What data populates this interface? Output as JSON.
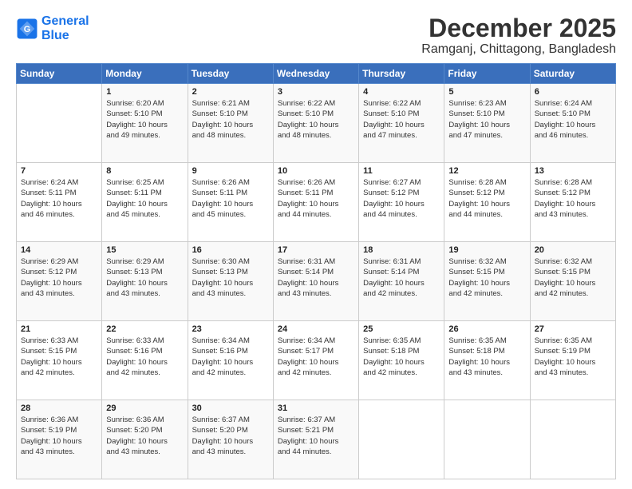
{
  "logo": {
    "line1": "General",
    "line2": "Blue"
  },
  "title": "December 2025",
  "location": "Ramganj, Chittagong, Bangladesh",
  "days_of_week": [
    "Sunday",
    "Monday",
    "Tuesday",
    "Wednesday",
    "Thursday",
    "Friday",
    "Saturday"
  ],
  "weeks": [
    [
      {
        "day": "",
        "info": ""
      },
      {
        "day": "1",
        "info": "Sunrise: 6:20 AM\nSunset: 5:10 PM\nDaylight: 10 hours\nand 49 minutes."
      },
      {
        "day": "2",
        "info": "Sunrise: 6:21 AM\nSunset: 5:10 PM\nDaylight: 10 hours\nand 48 minutes."
      },
      {
        "day": "3",
        "info": "Sunrise: 6:22 AM\nSunset: 5:10 PM\nDaylight: 10 hours\nand 48 minutes."
      },
      {
        "day": "4",
        "info": "Sunrise: 6:22 AM\nSunset: 5:10 PM\nDaylight: 10 hours\nand 47 minutes."
      },
      {
        "day": "5",
        "info": "Sunrise: 6:23 AM\nSunset: 5:10 PM\nDaylight: 10 hours\nand 47 minutes."
      },
      {
        "day": "6",
        "info": "Sunrise: 6:24 AM\nSunset: 5:10 PM\nDaylight: 10 hours\nand 46 minutes."
      }
    ],
    [
      {
        "day": "7",
        "info": "Sunrise: 6:24 AM\nSunset: 5:11 PM\nDaylight: 10 hours\nand 46 minutes."
      },
      {
        "day": "8",
        "info": "Sunrise: 6:25 AM\nSunset: 5:11 PM\nDaylight: 10 hours\nand 45 minutes."
      },
      {
        "day": "9",
        "info": "Sunrise: 6:26 AM\nSunset: 5:11 PM\nDaylight: 10 hours\nand 45 minutes."
      },
      {
        "day": "10",
        "info": "Sunrise: 6:26 AM\nSunset: 5:11 PM\nDaylight: 10 hours\nand 44 minutes."
      },
      {
        "day": "11",
        "info": "Sunrise: 6:27 AM\nSunset: 5:12 PM\nDaylight: 10 hours\nand 44 minutes."
      },
      {
        "day": "12",
        "info": "Sunrise: 6:28 AM\nSunset: 5:12 PM\nDaylight: 10 hours\nand 44 minutes."
      },
      {
        "day": "13",
        "info": "Sunrise: 6:28 AM\nSunset: 5:12 PM\nDaylight: 10 hours\nand 43 minutes."
      }
    ],
    [
      {
        "day": "14",
        "info": "Sunrise: 6:29 AM\nSunset: 5:12 PM\nDaylight: 10 hours\nand 43 minutes."
      },
      {
        "day": "15",
        "info": "Sunrise: 6:29 AM\nSunset: 5:13 PM\nDaylight: 10 hours\nand 43 minutes."
      },
      {
        "day": "16",
        "info": "Sunrise: 6:30 AM\nSunset: 5:13 PM\nDaylight: 10 hours\nand 43 minutes."
      },
      {
        "day": "17",
        "info": "Sunrise: 6:31 AM\nSunset: 5:14 PM\nDaylight: 10 hours\nand 43 minutes."
      },
      {
        "day": "18",
        "info": "Sunrise: 6:31 AM\nSunset: 5:14 PM\nDaylight: 10 hours\nand 42 minutes."
      },
      {
        "day": "19",
        "info": "Sunrise: 6:32 AM\nSunset: 5:15 PM\nDaylight: 10 hours\nand 42 minutes."
      },
      {
        "day": "20",
        "info": "Sunrise: 6:32 AM\nSunset: 5:15 PM\nDaylight: 10 hours\nand 42 minutes."
      }
    ],
    [
      {
        "day": "21",
        "info": "Sunrise: 6:33 AM\nSunset: 5:15 PM\nDaylight: 10 hours\nand 42 minutes."
      },
      {
        "day": "22",
        "info": "Sunrise: 6:33 AM\nSunset: 5:16 PM\nDaylight: 10 hours\nand 42 minutes."
      },
      {
        "day": "23",
        "info": "Sunrise: 6:34 AM\nSunset: 5:16 PM\nDaylight: 10 hours\nand 42 minutes."
      },
      {
        "day": "24",
        "info": "Sunrise: 6:34 AM\nSunset: 5:17 PM\nDaylight: 10 hours\nand 42 minutes."
      },
      {
        "day": "25",
        "info": "Sunrise: 6:35 AM\nSunset: 5:18 PM\nDaylight: 10 hours\nand 42 minutes."
      },
      {
        "day": "26",
        "info": "Sunrise: 6:35 AM\nSunset: 5:18 PM\nDaylight: 10 hours\nand 43 minutes."
      },
      {
        "day": "27",
        "info": "Sunrise: 6:35 AM\nSunset: 5:19 PM\nDaylight: 10 hours\nand 43 minutes."
      }
    ],
    [
      {
        "day": "28",
        "info": "Sunrise: 6:36 AM\nSunset: 5:19 PM\nDaylight: 10 hours\nand 43 minutes."
      },
      {
        "day": "29",
        "info": "Sunrise: 6:36 AM\nSunset: 5:20 PM\nDaylight: 10 hours\nand 43 minutes."
      },
      {
        "day": "30",
        "info": "Sunrise: 6:37 AM\nSunset: 5:20 PM\nDaylight: 10 hours\nand 43 minutes."
      },
      {
        "day": "31",
        "info": "Sunrise: 6:37 AM\nSunset: 5:21 PM\nDaylight: 10 hours\nand 44 minutes."
      },
      {
        "day": "",
        "info": ""
      },
      {
        "day": "",
        "info": ""
      },
      {
        "day": "",
        "info": ""
      }
    ]
  ]
}
